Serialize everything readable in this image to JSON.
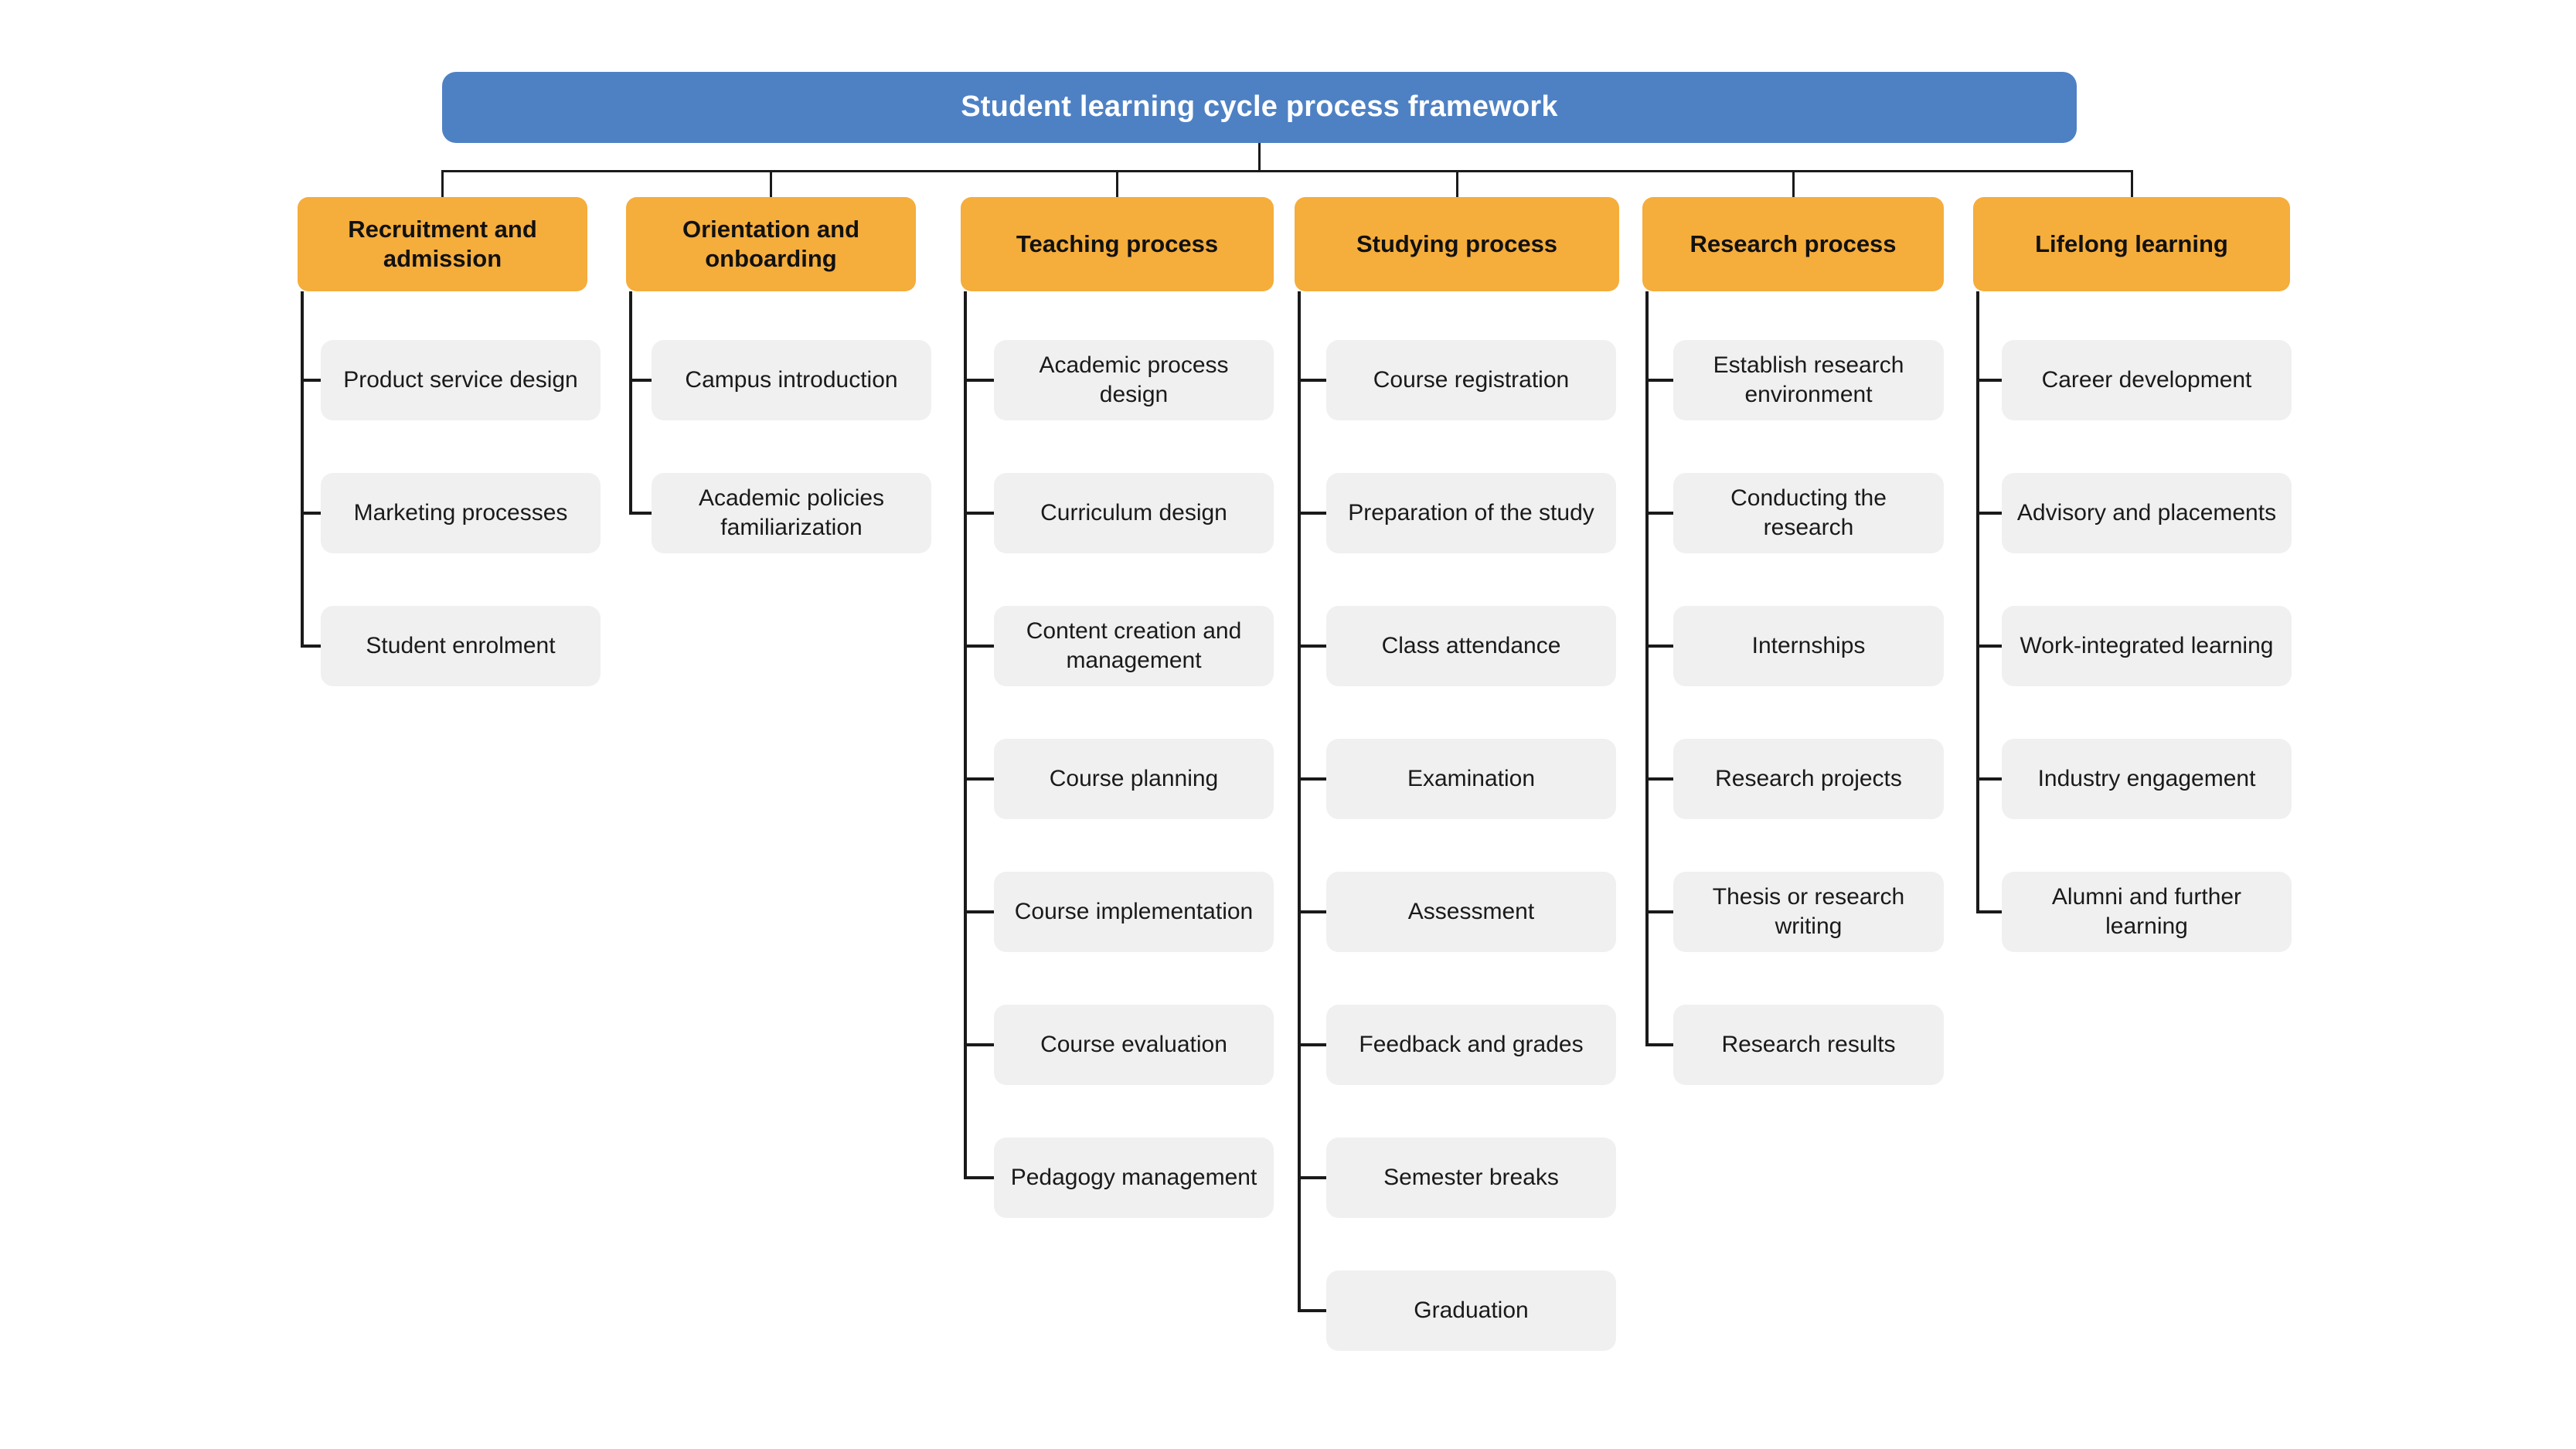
{
  "diagram": {
    "title": "Student learning cycle process framework",
    "colors": {
      "root_fill": "#4E81C4",
      "root_text": "#FFFFFF",
      "header_fill": "#F5AD3C",
      "header_text": "#111111",
      "leaf_fill": "#F0F0F0",
      "leaf_text": "#1A1A1A",
      "connector": "#1A1A1A",
      "background": "#FFFFFF"
    },
    "columns": [
      {
        "id": "recruitment-and-admission",
        "header": "Recruitment and admission",
        "items": [
          "Product service design",
          "Marketing processes",
          "Student enrolment"
        ]
      },
      {
        "id": "orientation-and-onboarding",
        "header": "Orientation and onboarding",
        "items": [
          "Campus introduction",
          "Academic policies familiarization"
        ]
      },
      {
        "id": "teaching-process",
        "header": "Teaching process",
        "items": [
          "Academic process design",
          "Curriculum design",
          "Content creation and management",
          "Course planning",
          "Course implementation",
          "Course evaluation",
          "Pedagogy management"
        ]
      },
      {
        "id": "studying-process",
        "header": "Studying process",
        "items": [
          "Course registration",
          "Preparation of the study",
          "Class attendance",
          "Examination",
          "Assessment",
          "Feedback and grades",
          "Semester breaks",
          "Graduation"
        ]
      },
      {
        "id": "research-process",
        "header": "Research process",
        "items": [
          "Establish research environment",
          "Conducting the research",
          "Internships",
          "Research projects",
          "Thesis or research writing",
          "Research results"
        ]
      },
      {
        "id": "lifelong-learning",
        "header": "Lifelong learning",
        "items": [
          "Career development",
          "Advisory and placements",
          "Work-integrated learning",
          "Industry engagement",
          "Alumni and further learning"
        ]
      }
    ]
  }
}
